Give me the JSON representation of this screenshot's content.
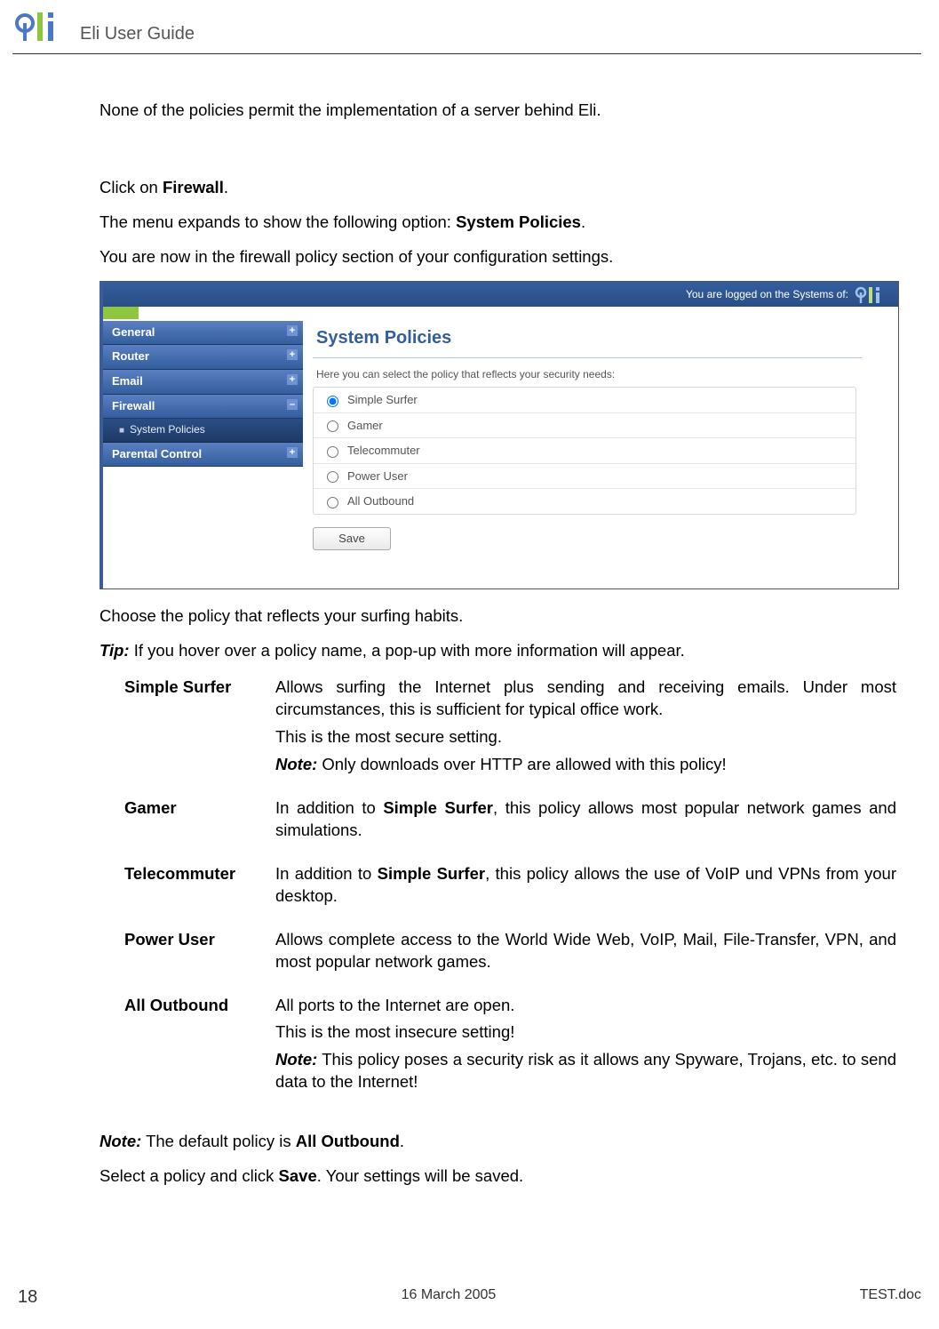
{
  "header": {
    "title": "Eli User Guide"
  },
  "body": {
    "intro1": "None of the policies permit the implementation of a server behind Eli.",
    "click_prefix": "Click on ",
    "click_target": "Firewall",
    "click_suffix": ".",
    "expand_prefix": "The menu expands to show the following option: ",
    "expand_target": "System Policies",
    "expand_suffix": ".",
    "now_in": "You are now in the firewall policy section of your configuration settings.",
    "choose": "Choose the policy that reflects your surfing habits.",
    "tip_label": "Tip:",
    "tip_text": " If you hover over a policy name, a pop-up with more information will appear."
  },
  "shot": {
    "banner": "You are logged on the Systems of:",
    "nav": {
      "general": "General",
      "router": "Router",
      "email": "Email",
      "firewall": "Firewall",
      "sys_pol": "System Policies",
      "parental": "Parental Control"
    },
    "right": {
      "title": "System Policies",
      "desc": "Here you can select the policy that reflects your security needs:",
      "opts": [
        "Simple Surfer",
        "Gamer",
        "Telecommuter",
        "Power User",
        "All Outbound"
      ],
      "save": "Save"
    }
  },
  "defs": [
    {
      "term": "Simple Surfer",
      "p1a": "Allows surfing the Internet plus sending and receiving emails. Under most circumstances, this is sufficient for typical office work.",
      "p2": "This is the most secure setting.",
      "note_label": "Note:",
      "note_text": " Only downloads over HTTP are allowed with this policy!"
    },
    {
      "term": "Gamer",
      "p_pre": "In addition to ",
      "p_bold": "Simple Surfer",
      "p_post": ", this policy allows most popular network games and simulations."
    },
    {
      "term": "Telecommuter",
      "p_pre": "In addition to ",
      "p_bold": "Simple Surfer",
      "p_post": ", this policy allows the use of VoIP und VPNs from your desktop."
    },
    {
      "term": "Power User",
      "p": "Allows complete access to the World Wide Web, VoIP, Mail, File-Transfer, VPN, and most popular network games."
    },
    {
      "term": "All Outbound",
      "p1": "All ports to the Internet are open.",
      "p2": "This is the most insecure setting!",
      "note_label": "Note:",
      "note_text": " This policy poses a security risk as it allows any Spyware, Trojans, etc. to send data to the Internet!"
    }
  ],
  "tail": {
    "note_label": "Note:",
    "note_pre": " The default policy is ",
    "note_bold": "All Outbound",
    "note_suf": ".",
    "save_pre": "Select a policy and click ",
    "save_bold": "Save",
    "save_suf": ". Your settings will be saved."
  },
  "footer": {
    "page": "18",
    "date": "16 March 2005",
    "file": "TEST.doc"
  }
}
